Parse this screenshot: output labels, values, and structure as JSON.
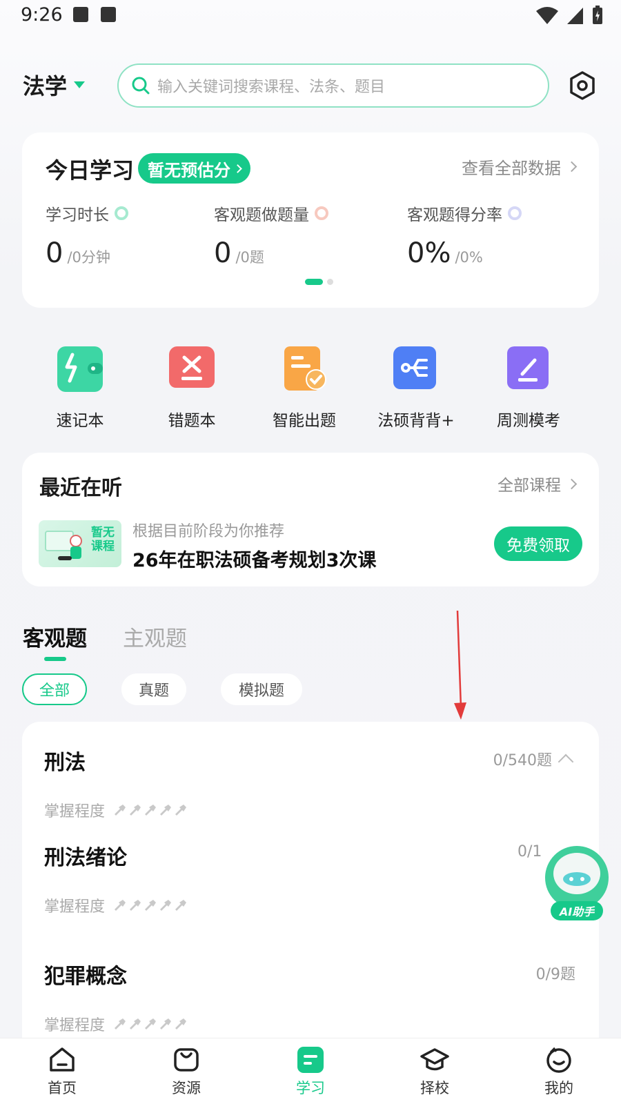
{
  "status_bar": {
    "time": "9:26"
  },
  "header": {
    "subject": "法学",
    "search_placeholder": "输入关键词搜索课程、法条、题目"
  },
  "today": {
    "title": "今日学习",
    "badge": "暂无预估分",
    "view_all": "查看全部数据",
    "stats": [
      {
        "label": "学习时长",
        "value": "0",
        "total": "/0分钟",
        "ring_color": "#a6ead0"
      },
      {
        "label": "客观题做题量",
        "value": "0",
        "total": "/0题",
        "ring_color": "#f7c9bf"
      },
      {
        "label": "客观题得分率",
        "value": "0%",
        "total": "/0%",
        "ring_color": "#d5d7f6"
      }
    ],
    "page_indicator": {
      "current": 1,
      "total": 2
    }
  },
  "tools": [
    {
      "label": "速记本",
      "icon": "notebook-icon",
      "color": "#3dd6a4"
    },
    {
      "label": "错题本",
      "icon": "wrong-book-icon",
      "color": "#f26a6a"
    },
    {
      "label": "智能出题",
      "icon": "smart-question-icon",
      "color": "#f9a646"
    },
    {
      "label": "法硕背背+",
      "icon": "memorize-icon",
      "color": "#4f7ff5"
    },
    {
      "label": "周测模考",
      "icon": "weekly-test-icon",
      "color": "#8a6ef5"
    }
  ],
  "recent": {
    "title": "最近在听",
    "all_courses": "全部课程",
    "thumb_text_line1": "暂无",
    "thumb_text_line2": "课程",
    "hint": "根据目前阶段为你推荐",
    "course_name": "26年在职法硕备考规划3次课",
    "cta": "免费领取"
  },
  "tabs": {
    "objective": "客观题",
    "subjective": "主观题"
  },
  "filters": [
    "全部",
    "真题",
    "模拟题"
  ],
  "subjects": [
    {
      "title": "刑法",
      "count": "0/540题",
      "mastery_label": "掌握程度",
      "expanded": true
    },
    {
      "title": "刑法绪论",
      "count": "0/1",
      "mastery_label": "掌握程度"
    },
    {
      "title": "犯罪概念",
      "count": "0/9题",
      "mastery_label": "掌握程度"
    }
  ],
  "ai_helper": {
    "label": "AI助手"
  },
  "bottom_nav": [
    {
      "label": "首页",
      "icon": "home-icon",
      "active": false
    },
    {
      "label": "资源",
      "icon": "bag-icon",
      "active": false
    },
    {
      "label": "学习",
      "icon": "study-icon",
      "active": true
    },
    {
      "label": "择校",
      "icon": "graduation-cap-icon",
      "active": false
    },
    {
      "label": "我的",
      "icon": "profile-icon",
      "active": false
    }
  ],
  "colors": {
    "accent": "#17c98a",
    "annotation_arrow": "#e23b3b"
  }
}
